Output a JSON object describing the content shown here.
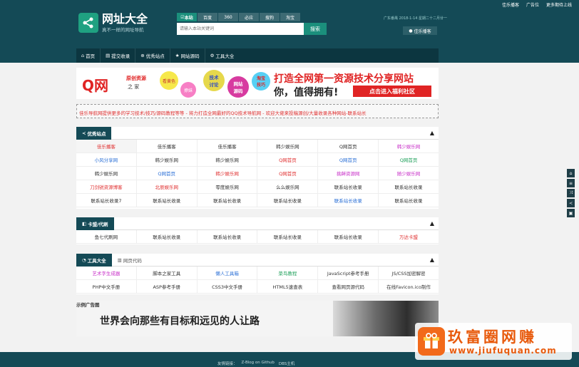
{
  "top_links": [
    "佳乐播客",
    "广告位",
    "更多期待上线"
  ],
  "logo": {
    "title": "网址大全",
    "subtitle": "真不一样的网址导航"
  },
  "search": {
    "engines": [
      "本站",
      "百度",
      "360",
      "必应",
      "搜狗",
      "淘宝"
    ],
    "active_engine": "本站",
    "placeholder": "请输入本站关键词",
    "button": "搜索"
  },
  "weather": "广东番禺  2018-1-14 星期二十二月廿一",
  "site_tag": "佳乐播客",
  "nav": [
    {
      "icon": "home-icon",
      "label": "首页"
    },
    {
      "icon": "submit-icon",
      "label": "提交收录"
    },
    {
      "icon": "plus-icon",
      "label": "优秀站点"
    },
    {
      "icon": "star-icon",
      "label": "网站源码"
    },
    {
      "icon": "gear-icon",
      "label": "工具大全"
    }
  ],
  "banner": {
    "logo_text": "Q网",
    "logo_sub": "原创资源",
    "logo_sub2": "之  家",
    "bubbles": [
      "看黄色",
      "撩妹",
      "技术\n讨论",
      "网站\n源码",
      "淘宝\n技巧"
    ],
    "headline1": "打造全网第一资源技术分享网站",
    "headline2": "你，值得拥有!",
    "cta": "点击进入福利社区"
  },
  "notice": "佳乐导航网提供更多的学习技术/技巧/源码教程等等 - 将力打造全网最好的QQ技术导航网 - 欢迎大佬来投稿源创/大量收录各种网站-联系站长",
  "panels": {
    "sites": {
      "title": "优秀站点",
      "rows": [
        [
          "佳乐播客",
          "佳乐播客",
          "佳乐播客",
          "韩少娱乐网",
          "Q网首页",
          "韩少娱乐网"
        ],
        [
          "小风分享网",
          "韩少娱乐网",
          "韩少娱乐网",
          "Q网首页",
          "Q网首页",
          "Q网首页"
        ],
        [
          "韩少娱乐网",
          "Q网首页",
          "韩少娱乐网",
          "Q网首页",
          "挑衅资源网",
          "随少娱乐网"
        ],
        [
          "刀剑锐资源博客",
          "北辰娱乐网",
          "零度娱乐网",
          "么么娱乐网",
          "联系站长收录",
          "联系站长收录"
        ],
        [
          "联系站长收录7",
          "联系站长收录",
          "联系站长收录",
          "联系站长收录",
          "联系站长收录",
          "联系站长收录"
        ]
      ]
    },
    "cards": {
      "title": "卡盟/代刷",
      "rows": [
        [
          "鱼七代刷网",
          "联系站长收录",
          "联系站长收录",
          "联系站长收录",
          "联系站长收录",
          "万达卡盟"
        ]
      ]
    },
    "tools": {
      "title": "工具大全",
      "tab2": "网页代码",
      "rows": [
        [
          "艺术字生成器",
          "脚本之家工具",
          "懒人工具箱",
          "菜鸟教程",
          "JavaScript参考手册",
          "JS/CSS加密解密"
        ],
        [
          "PHP中文手册",
          "ASP参考手册",
          "CSS3中文手册",
          "HTML5速查表",
          "查看网页源代码",
          "在线Favicon.ico制作"
        ]
      ]
    }
  },
  "ad": {
    "label": "示例广告图",
    "text": "世界会向那些有目标和远见的人让路"
  },
  "footer": {
    "label": "友情链接：",
    "links": [
      "Z-Blog on Github",
      "DBS主机"
    ]
  },
  "side_tools": [
    "home-icon",
    "list-icon",
    "shuffle-icon",
    "share-icon",
    "bookmark-icon"
  ],
  "watermark": {
    "title": "玖富圈网赚",
    "url": "www.jiufuquan.com"
  },
  "colors": {
    "header": "#144a56",
    "accent": "#1b8f7c",
    "red": "#e03030",
    "blue": "#2a6fd6",
    "green": "#1ea05a",
    "magenta": "#c830c8",
    "orange": "#e85a0c"
  }
}
